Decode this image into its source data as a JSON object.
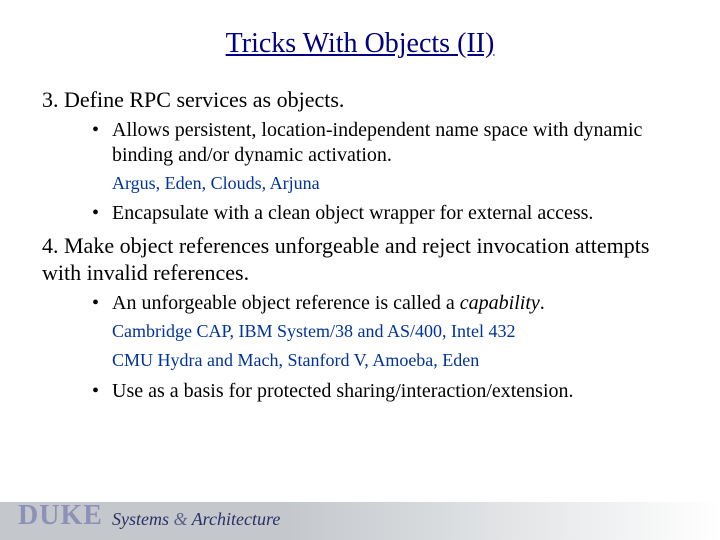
{
  "title": "Tricks With Objects (II)",
  "items": {
    "n3": "3. Define RPC services as objects.",
    "n3_b1": "Allows persistent, location-independent name space with dynamic binding and/or dynamic activation.",
    "n3_sub1": "Argus, Eden, Clouds, Arjuna",
    "n3_b2": "Encapsulate with a clean object wrapper for external access.",
    "n4": "4. Make object references unforgeable and reject invocation attempts with invalid references.",
    "n4_b1_pre": "An unforgeable object reference is called a ",
    "n4_b1_em": "capability",
    "n4_b1_post": ".",
    "n4_sub1": "Cambridge CAP, IBM System/38 and AS/400, Intel 432",
    "n4_sub2": "CMU Hydra and Mach, Stanford V, Amoeba, Eden",
    "n4_b2": "Use as a basis for protected sharing/interaction/extension."
  },
  "footer": {
    "duke": "DUKE",
    "systems": "Systems",
    "amp": " & ",
    "arch": "Architecture"
  }
}
